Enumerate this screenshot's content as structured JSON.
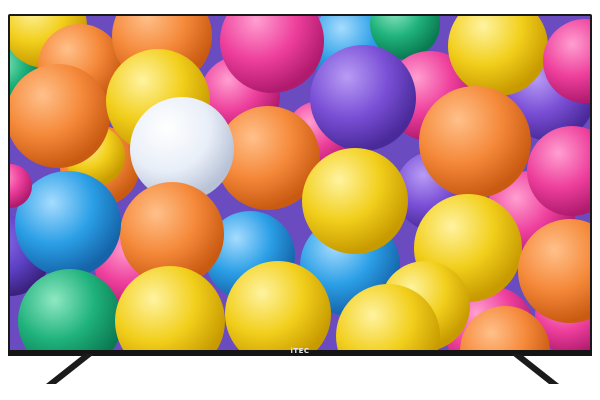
{
  "tv": {
    "brand_logo": "iTEC"
  },
  "scene": {
    "subject": "ball-pit",
    "colors": {
      "orange": "#f5893a",
      "yellow": "#f2cf1c",
      "pink": "#ee3f9c",
      "magenta": "#e0329a",
      "purple": "#7a4fd6",
      "blue": "#2b9fe6",
      "light-blue": "#5bb8ef",
      "green": "#1fb27c",
      "white": "#e8eef8",
      "bezel": "#1a1a1a"
    }
  }
}
